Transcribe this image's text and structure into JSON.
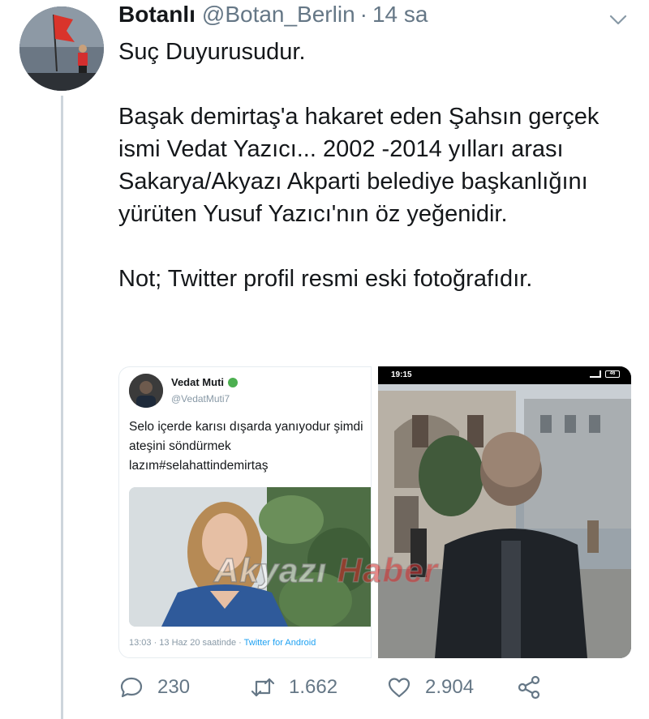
{
  "tweet": {
    "display_name": "Botanlı",
    "handle": "@Botan_Berlin",
    "separator": "·",
    "time": "14 sa",
    "paragraphs": [
      "Suç Duyurusudur.",
      "",
      "Başak demirtaş'a hakaret eden Şahsın gerçek ismi Vedat Yazıcı... 2002 -2014 yılları arası Sakarya/Akyazı Akparti belediye başkanlığını yürüten Yusuf Yazıcı'nın öz yeğenidir.",
      "",
      "Not; Twitter profil resmi eski fotoğrafıdır."
    ]
  },
  "embedded_tweet": {
    "name": "Vedat Muti",
    "handle": "@VedatMuti7",
    "text": "Selo içerde karısı dışarda yanıyodur şimdi ateşini söndürmek lazım#selahattindemirtaş",
    "footer_time": "13:03 · 13 Haz 20 saatinde · ",
    "footer_app": "Twitter for Android",
    "verified_color": "#4caf50"
  },
  "phone_screenshot": {
    "status_time": "19:15",
    "battery": "46"
  },
  "watermark": {
    "part1": "Akyazı",
    "part2": "Haber"
  },
  "actions": {
    "replies": "230",
    "retweets": "1.662",
    "likes": "2.904"
  },
  "icons": {
    "reply": "reply-icon",
    "retweet": "retweet-icon",
    "like": "heart-icon",
    "share": "share-icon",
    "more": "chevron-down-icon"
  },
  "colors": {
    "text": "#14171a",
    "secondary": "#657786",
    "thread_line": "#cdd5dc",
    "link": "#1da1f2"
  }
}
